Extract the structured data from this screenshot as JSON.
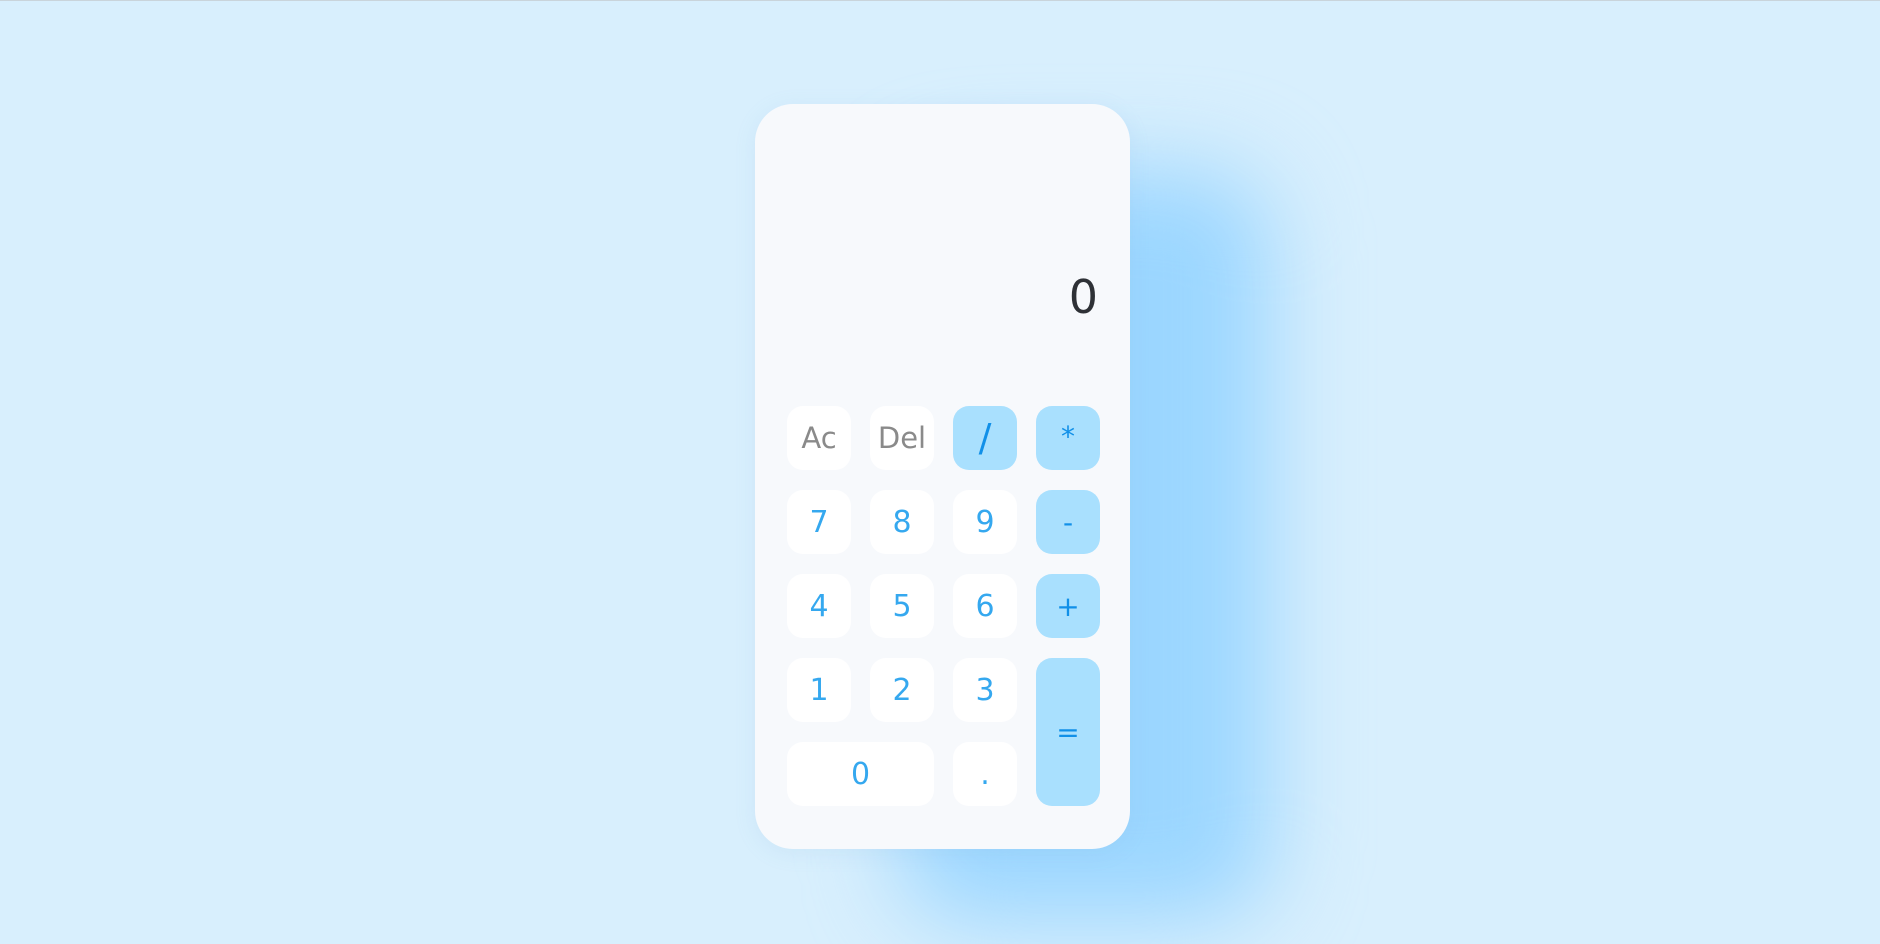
{
  "display": {
    "value": "0"
  },
  "keys": {
    "clear": "Ac",
    "delete": "Del",
    "divide": "/",
    "multiply": "*",
    "seven": "7",
    "eight": "8",
    "nine": "9",
    "subtract": "-",
    "four": "4",
    "five": "5",
    "six": "6",
    "add": "+",
    "one": "1",
    "two": "2",
    "three": "3",
    "equals": "=",
    "zero": "0",
    "decimal": "."
  },
  "colors": {
    "background": "#d8effd",
    "panel": "#f7f9fc",
    "digit_text": "#35a8ef",
    "operator_bg": "#a9e0fe",
    "operator_text": "#1190e8",
    "function_text": "#8a8a8a",
    "display_text": "#2e3136"
  }
}
